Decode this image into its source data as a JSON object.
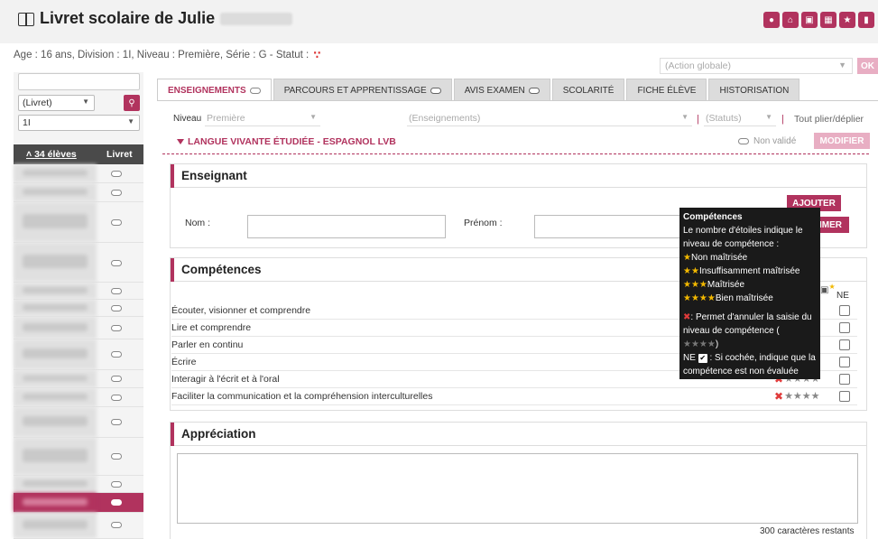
{
  "header": {
    "title": "Livret scolaire de Julie",
    "icons": [
      "people-icon",
      "building-icon",
      "document-icon",
      "calendar-icon",
      "star-icon",
      "bag-icon"
    ]
  },
  "student_info": "Age : 16 ans, Division : 1I, Niveau : Première, Série : G - Statut :",
  "action_globale": {
    "placeholder": "(Action globale)",
    "ok_label": "OK"
  },
  "left_panel": {
    "livret_select": "(Livret)",
    "class_select": "1I",
    "list_header_students": "34 élèves",
    "list_header_livret": "Livret"
  },
  "tabs": [
    {
      "label": "ENSEIGNEMENTS"
    },
    {
      "label": "PARCOURS ET APPRENTISSAGE"
    },
    {
      "label": "AVIS EXAMEN"
    },
    {
      "label": "SCOLARITÉ"
    },
    {
      "label": "FICHE ÉLÈVE"
    },
    {
      "label": "HISTORISATION"
    }
  ],
  "filters": {
    "niveau_label": "Niveau",
    "niveau_value": "Première",
    "enseignements": "(Enseignements)",
    "statuts": "(Statuts)",
    "plier": "Tout plier/déplier"
  },
  "section": {
    "title": "LANGUE VIVANTE ÉTUDIÉE - ESPAGNOL LVB",
    "status": "Non validé",
    "modifier": "MODIFIER"
  },
  "enseignant": {
    "title": "Enseignant",
    "nom_label": "Nom :",
    "prenom_label": "Prénom :",
    "ajouter": "AJOUTER",
    "supprimer": "IMER"
  },
  "competences": {
    "title": "Compétences",
    "ne_label": "NE",
    "items": [
      "Écouter, visionner et comprendre",
      "Lire et comprendre",
      "Parler en continu",
      "Écrire",
      "Interagir à l'écrit et à l'oral",
      "Faciliter la communication et la compréhension interculturelles"
    ]
  },
  "appreciation": {
    "title": "Appréciation",
    "remaining": "300 caractères restants"
  },
  "tooltip": {
    "title": "Compétences",
    "intro": "Le nombre d'étoiles indique le niveau de compétence :",
    "level1": "Non maîtrisée",
    "level2": "Insuffisamment maîtrisée",
    "level3": "Maîtrisée",
    "level4": "Bien maîtrisée",
    "cancel_text": ": Permet d'annuler la saisie du niveau de compétence (",
    "cancel_end": ")",
    "ne_prefix": "NE",
    "ne_text": ": Si cochée, indique que la compétence est non évaluée"
  },
  "colors": {
    "accent": "#b1335e",
    "accent_light": "#e8aec3",
    "dark": "#4a4a4a"
  }
}
